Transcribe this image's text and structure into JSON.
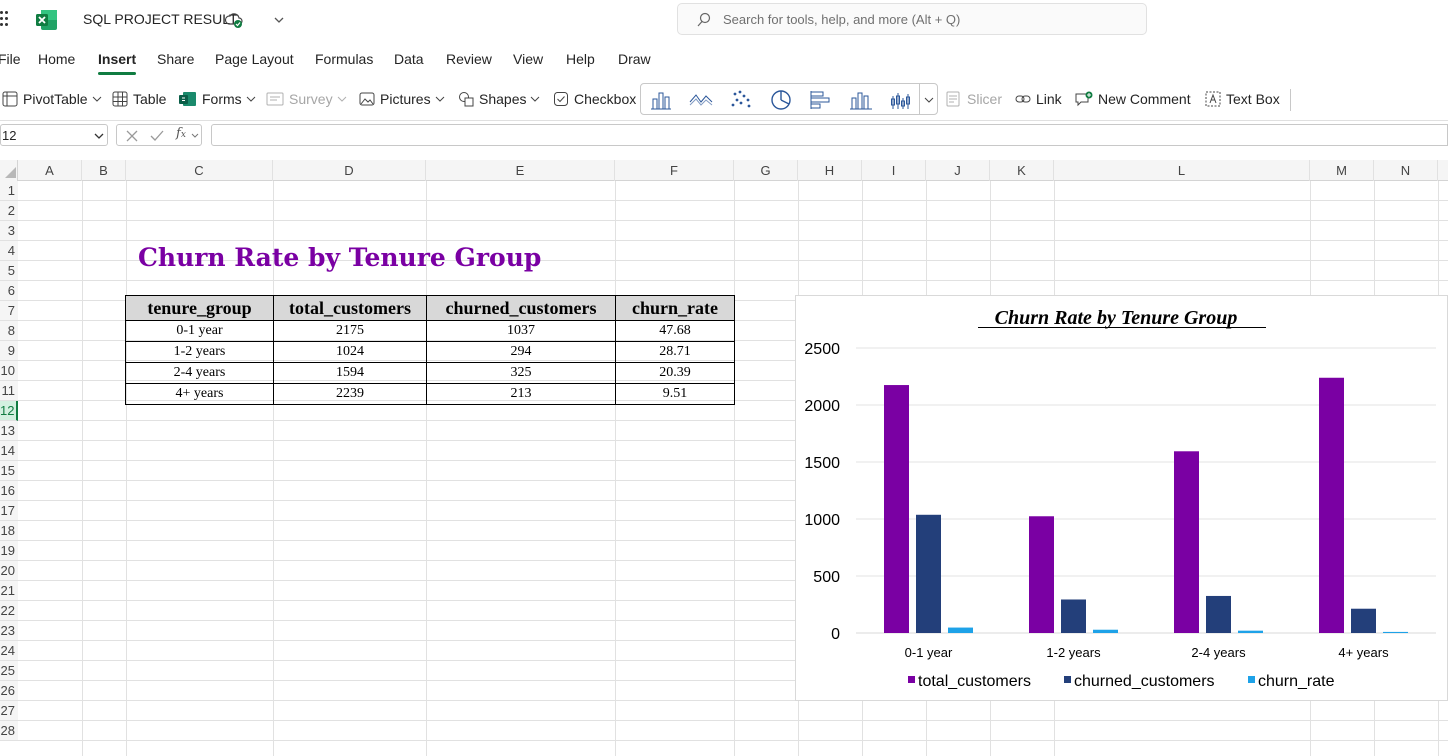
{
  "app": {
    "title": "SQL PROJECT RESULT",
    "search_placeholder": "Search for tools, help, and more (Alt + Q)",
    "accent": "#107c41"
  },
  "menu": {
    "tabs": [
      "File",
      "Home",
      "Insert",
      "Share",
      "Page Layout",
      "Formulas",
      "Data",
      "Review",
      "View",
      "Help",
      "Draw"
    ],
    "active": "Insert"
  },
  "ribbon": {
    "pivottable": "PivotTable",
    "table": "Table",
    "forms": "Forms",
    "survey": "Survey",
    "pictures": "Pictures",
    "shapes": "Shapes",
    "checkbox": "Checkbox",
    "slicer": "Slicer",
    "link": "Link",
    "new_comment": "New Comment",
    "text_box": "Text Box"
  },
  "formula_bar": {
    "name_box": "12",
    "formula": ""
  },
  "grid": {
    "columns": [
      "A",
      "B",
      "C",
      "D",
      "E",
      "F",
      "G",
      "H",
      "I",
      "J",
      "K",
      "L",
      "M",
      "N"
    ],
    "rows": [
      "1",
      "2",
      "3",
      "4",
      "5",
      "6",
      "7",
      "8",
      "9",
      "10",
      "11",
      "12",
      "13",
      "14",
      "15",
      "16",
      "17",
      "18",
      "19",
      "20",
      "21",
      "22",
      "23",
      "24",
      "25",
      "26",
      "27",
      "28"
    ],
    "selected_row": "12"
  },
  "sheet": {
    "title": "Churn Rate by Tenure Group",
    "headers": [
      "tenure_group",
      "total_customers",
      "churned_customers",
      "churn_rate"
    ],
    "rows": [
      [
        "0-1 year",
        "2175",
        "1037",
        "47.68"
      ],
      [
        "1-2 years",
        "1024",
        "294",
        "28.71"
      ],
      [
        "2-4 years",
        "1594",
        "325",
        "20.39"
      ],
      [
        "4+ years",
        "2239",
        "213",
        "9.51"
      ]
    ]
  },
  "chart_data": {
    "type": "bar",
    "title": "Churn Rate by Tenure Group",
    "categories": [
      "0-1 year",
      "1-2 years",
      "2-4 years",
      "4+ years"
    ],
    "series": [
      {
        "name": "total_customers",
        "values": [
          2175,
          1024,
          1594,
          2239
        ],
        "color": "#7a00a3"
      },
      {
        "name": "churned_customers",
        "values": [
          1037,
          294,
          325,
          213
        ],
        "color": "#233f7a"
      },
      {
        "name": "churn_rate",
        "values": [
          47.68,
          28.71,
          20.39,
          9.51
        ],
        "color": "#1ea2e8"
      }
    ],
    "ylim": [
      0,
      2500
    ],
    "yticks": [
      "0",
      "500",
      "1000",
      "1500",
      "2000",
      "2500"
    ],
    "grid": true,
    "legend": "bottom"
  }
}
